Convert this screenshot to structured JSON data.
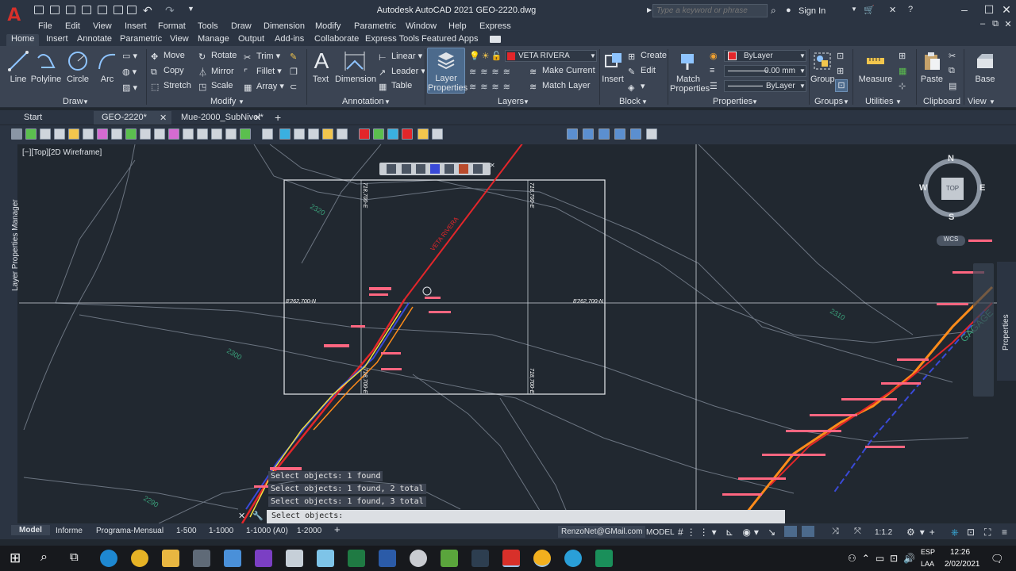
{
  "app": {
    "logo": "A",
    "title": "Autodesk AutoCAD 2021   GEO-2220.dwg"
  },
  "search": {
    "placeholder": "Type a keyword or phrase"
  },
  "account": {
    "sign_in": "Sign In"
  },
  "menus": [
    "File",
    "Edit",
    "View",
    "Insert",
    "Format",
    "Tools",
    "Draw",
    "Dimension",
    "Modify",
    "Parametric",
    "Window",
    "Help",
    "Express"
  ],
  "ribbon_tabs": [
    "Home",
    "Insert",
    "Annotate",
    "Parametric",
    "View",
    "Manage",
    "Output",
    "Add-ins",
    "Collaborate",
    "Express Tools",
    "Featured Apps"
  ],
  "ribbon": {
    "draw": {
      "title": "Draw",
      "line": "Line",
      "polyline": "Polyline",
      "circle": "Circle",
      "arc": "Arc"
    },
    "modify": {
      "title": "Modify",
      "move": "Move",
      "rotate": "Rotate",
      "trim": "Trim",
      "copy": "Copy",
      "mirror": "Mirror",
      "fillet": "Fillet",
      "stretch": "Stretch",
      "scale": "Scale",
      "array": "Array"
    },
    "annotation": {
      "title": "Annotation",
      "text": "Text",
      "dimension": "Dimension",
      "linear": "Linear",
      "leader": "Leader",
      "table": "Table"
    },
    "layers": {
      "title": "Layers",
      "layer_properties": "Layer Properties",
      "current_layer": "VETA RIVERA",
      "make_current": "Make Current",
      "match_layer": "Match Layer"
    },
    "block": {
      "title": "Block",
      "insert": "Insert",
      "create": "Create",
      "edit": "Edit"
    },
    "properties": {
      "title": "Properties",
      "match": "Match Properties",
      "color": "ByLayer",
      "lineweight": "0.00 mm",
      "linetype": "ByLayer"
    },
    "groups": {
      "title": "Groups",
      "group": "Group"
    },
    "utilities": {
      "title": "Utilities",
      "measure": "Measure"
    },
    "clipboard": {
      "title": "Clipboard",
      "paste": "Paste"
    },
    "view": {
      "title": "View",
      "base": "Base"
    }
  },
  "file_tabs": [
    "Start",
    "GEO-2220*",
    "Mue-2000_SubNivel*"
  ],
  "viewport": {
    "label": "[−][Top][2D Wireframe]",
    "cube_top": "TOP",
    "north": "N",
    "south": "S",
    "east": "E",
    "west": "W",
    "wcs": "WCS"
  },
  "drawing_labels": {
    "layer_name": "VETA RIVERA",
    "coord_e": "8'262,700-N",
    "coord_e2": "8'262,700-N",
    "coord_v1": "718,700-E",
    "coord_v2": "718,700-E",
    "coord_v3": "718,700-E",
    "coord_v4": "718,700-E",
    "contour_2320": "2320",
    "contour_2300": "2300",
    "contour_2290": "2290",
    "contour_2310": "2310",
    "gagage": "GAGAGE"
  },
  "side_panels": {
    "left": "Layer Properties Manager",
    "right": "Properties"
  },
  "command": {
    "history": [
      "Select objects: 1 found",
      "Select objects: 1 found, 2 total",
      "Select objects: 1 found, 3 total"
    ],
    "prompt": "Select objects:"
  },
  "layout_tabs": [
    "Model",
    "Informe",
    "Programa-Mensual",
    "1-500",
    "1-1000",
    "1-1000 (A0)",
    "1-2000"
  ],
  "status": {
    "email": "RenzoNet@GMail.com",
    "space": "MODEL",
    "scale": "1:1.2"
  },
  "taskbar": {
    "lang": "ESP",
    "layout": "LAA",
    "time": "12:26",
    "date": "2/02/2021"
  }
}
